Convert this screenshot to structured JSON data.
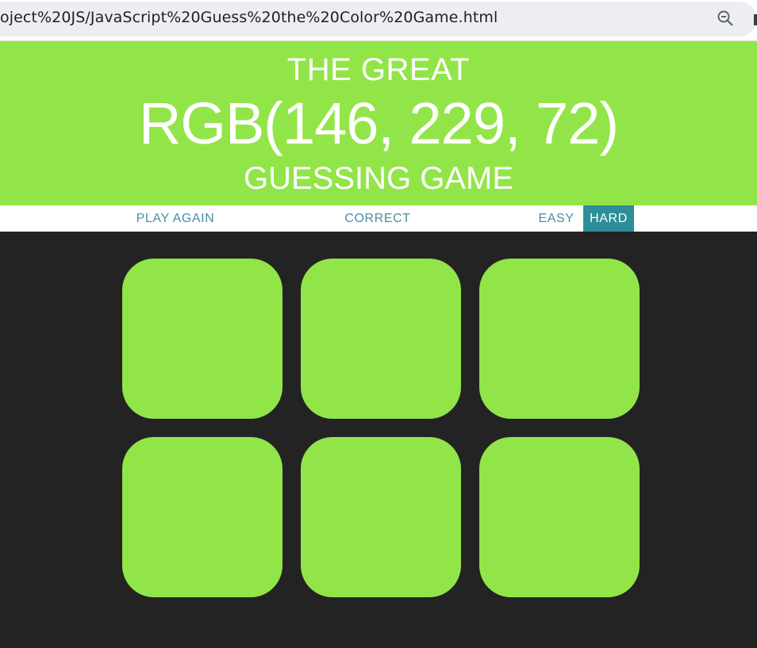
{
  "browser": {
    "address": "oject%20JS/JavaScript%20Guess%20the%20Color%20Game.html",
    "icons": [
      "zoom-out-icon"
    ]
  },
  "header": {
    "line1": "THE GREAT",
    "color_display": "RGB(146, 229, 72)",
    "line3": "GUESSING GAME"
  },
  "stripe": {
    "reset_label": "PLAY AGAIN",
    "message": "CORRECT",
    "easy_label": "EASY",
    "hard_label": "HARD",
    "selected_mode": "HARD"
  },
  "squares": [
    "rgb(146, 229, 72)",
    "rgb(146, 229, 72)",
    "rgb(146, 229, 72)",
    "rgb(146, 229, 72)",
    "rgb(146, 229, 72)",
    "rgb(146, 229, 72)"
  ],
  "colors": {
    "header_bg": "#92e548",
    "page_bg": "#232323",
    "accent": "#2c8e99",
    "stripe_text": "#4a8fa3"
  }
}
